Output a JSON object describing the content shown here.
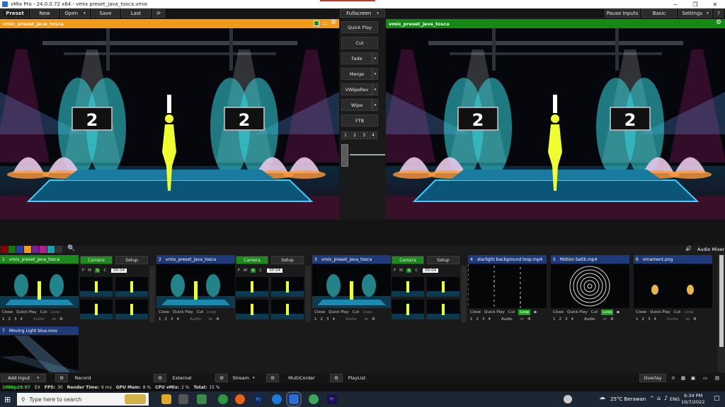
{
  "window": {
    "title": "vMix Pro - 24.0.0.72 x64 - vmix preset_java_tosca.vmix",
    "minimize": "─",
    "restore": "❐",
    "close": "✕"
  },
  "toolbar": {
    "preset": "Preset",
    "new": "New",
    "open": "Open",
    "save": "Save",
    "last": "Last",
    "fullscreen": "Fullscreen",
    "pause_inputs": "Pause Inputs",
    "basic": "Basic",
    "settings": "Settings",
    "help": "?"
  },
  "preview": {
    "title": "vmix_preset_java_tosca",
    "header_color": "#f39a1a"
  },
  "program": {
    "title": "vmix_preset_java_tosca",
    "header_color": "#138a13"
  },
  "transitions": {
    "buttons": [
      "Quick Play",
      "Cut",
      "Fade",
      "Merge",
      "VWipeRev",
      "Wipe",
      "FTB"
    ],
    "numbers": [
      "1",
      "2",
      "3",
      "4"
    ]
  },
  "swatches": [
    "#8b0000",
    "#0f7a0f",
    "#1f3fb0",
    "#f39a1a",
    "#7a1f9a",
    "#b01f8a",
    "#1aa0b0",
    "#333333"
  ],
  "audio_mixer": "Audio Mixer",
  "stage_number": "2",
  "inputs": [
    {
      "num": "1",
      "name": "vmix_preset_java_tosca",
      "header": "green"
    },
    {
      "num": "2",
      "name": "vmix_preset_java_tosca",
      "header": "blue"
    },
    {
      "num": "3",
      "name": "vmix_preset_java_tosca",
      "header": "blue"
    },
    {
      "num": "4",
      "name": "starlight background loop.mp4",
      "header": "blue"
    },
    {
      "num": "5",
      "name": "Motion batik.mp4",
      "header": "blue"
    },
    {
      "num": "6",
      "name": "ornament.png",
      "header": "blue"
    },
    {
      "num": "7",
      "name": "Moving Light blue.mov",
      "header": "blue"
    }
  ],
  "input_controls": {
    "close": "Close",
    "quick_play": "Quick Play",
    "cut": "Cut",
    "loop": "Loop",
    "audio": "Audio",
    "nums": [
      "1",
      "2",
      "3",
      "4"
    ]
  },
  "camera_panel": {
    "camera": "Camera",
    "setup": "Setup",
    "f": "F",
    "m": "M",
    "s": "S",
    "c": "C",
    "time": "00:04"
  },
  "bottom": {
    "add_input": "Add Input",
    "record": "Record",
    "external": "External",
    "stream": "Stream",
    "multicorder": "MultiCorder",
    "playlist": "PlayList",
    "overlay": "Overlay"
  },
  "status": {
    "format": "1080p29.97",
    "ex": "EX",
    "fps_label": "FPS:",
    "fps": "30",
    "render_label": "Render Time:",
    "render": "6 ms",
    "gpu_label": "GPU Mem:",
    "gpu": "8 %",
    "cpu_label": "CPU vMix:",
    "cpu": "2 %",
    "total_label": "Total:",
    "total": "15 %"
  },
  "taskbar": {
    "search_placeholder": "Type here to search",
    "weather": "25°C Berawan",
    "lang": "ENG",
    "time": "6:34 PM",
    "date": "10/7/2022"
  }
}
